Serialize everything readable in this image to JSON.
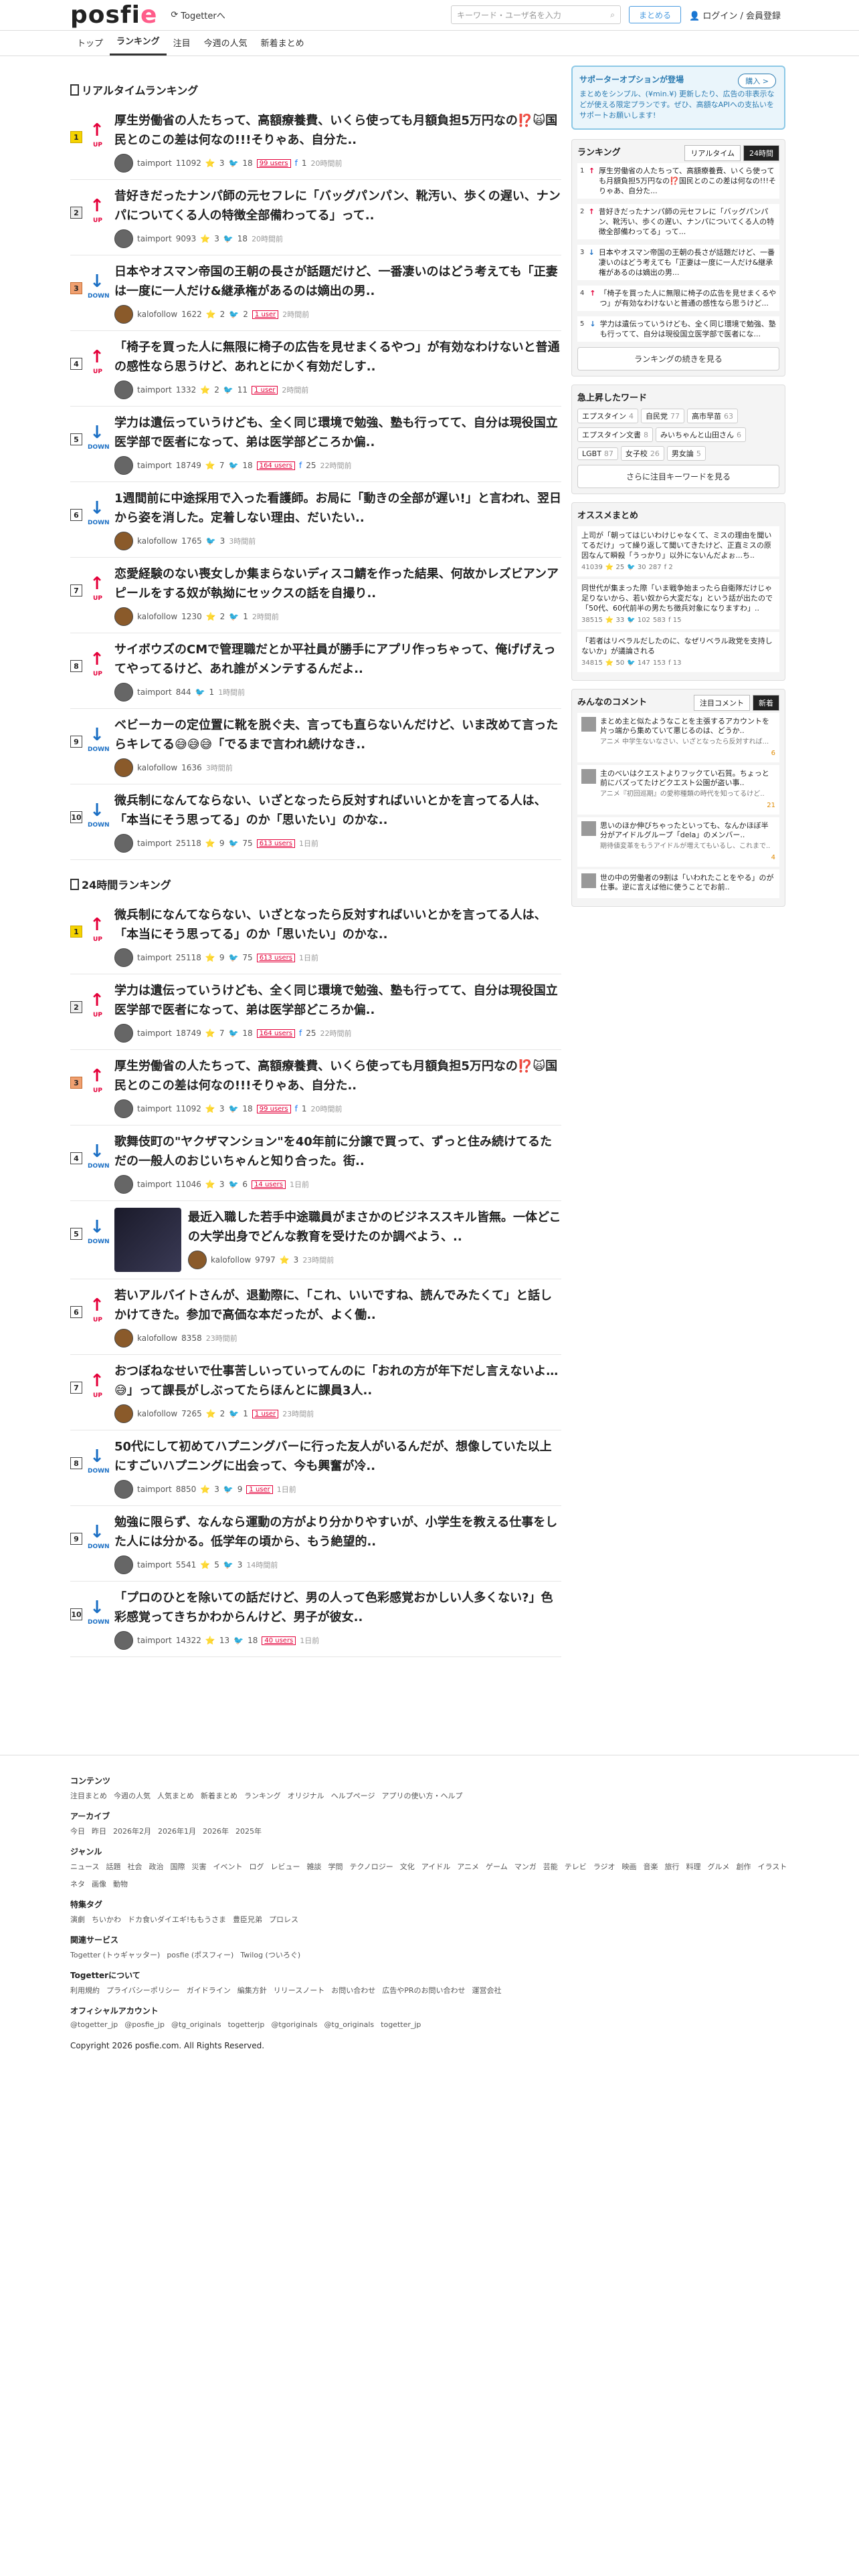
{
  "header": {
    "logo": "posfie",
    "togetter": "Togetterへ",
    "search_placeholder": "キーワード・ユーザ名を入力",
    "matome_btn": "まとめる",
    "login": "ログイン / 会員登録"
  },
  "nav": [
    "トップ",
    "ランキング",
    "注目",
    "今週の人気",
    "新着まとめ"
  ],
  "realtime": {
    "title": "リアルタイムランキング",
    "items": [
      {
        "n": "1",
        "dir": "UP",
        "title": "厚生労働省の人たちって、高額療養費、いくら使っても月額負担5万円なの⁉️🙀国民とのこの差は何なの!!!そりゃあ、自分た..",
        "user": "taimport",
        "views": "11092",
        "stars": "3",
        "tw": "18",
        "users": "99 users",
        "fb": "1",
        "time": "20時間前"
      },
      {
        "n": "2",
        "dir": "UP",
        "title": "昔好きだったナンパ師の元セフレに「バッグパンパン、靴汚い、歩くの遅い、ナンパについてくる人の特徴全部備わってる」って..",
        "user": "taimport",
        "views": "9093",
        "stars": "3",
        "tw": "18",
        "users": "",
        "fb": "",
        "time": "20時間前"
      },
      {
        "n": "3",
        "dir": "DOWN",
        "title": "日本やオスマン帝国の王朝の長さが話題だけど、一番凄いのはどう考えても「正妻は一度に一人だけ&継承権があるのは嫡出の男..",
        "user": "kalofollow",
        "views": "1622",
        "stars": "2",
        "tw": "2",
        "users": "1 user",
        "fb": "",
        "time": "2時間前"
      },
      {
        "n": "4",
        "dir": "UP",
        "title": "「椅子を買った人に無限に椅子の広告を見せまくるやつ」が有効なわけないと普通の感性なら思うけど、あれとにかく有効だしす..",
        "user": "taimport",
        "views": "1332",
        "stars": "2",
        "tw": "11",
        "users": "1 user",
        "fb": "",
        "time": "2時間前"
      },
      {
        "n": "5",
        "dir": "DOWN",
        "title": "学力は遺伝っていうけども、全く同じ環境で勉強、塾も行ってて、自分は現役国立医学部で医者になって、弟は医学部どころか偏..",
        "user": "taimport",
        "views": "18749",
        "stars": "7",
        "tw": "18",
        "users": "164 users",
        "fb": "25",
        "time": "22時間前"
      },
      {
        "n": "6",
        "dir": "DOWN",
        "title": "1週間前に中途採用で入った看護師。お局に「動きの全部が遅い!」と言われ、翌日から姿を消した。定着しない理由、だいたい..",
        "user": "kalofollow",
        "views": "1765",
        "stars": "",
        "tw": "3",
        "users": "",
        "fb": "",
        "time": "3時間前"
      },
      {
        "n": "7",
        "dir": "UP",
        "title": "恋愛経験のない喪女しか集まらないディスコ鯖を作った結果、何故かレズビアンアピールをする奴が執拗にセックスの話を自撮り..",
        "user": "kalofollow",
        "views": "1230",
        "stars": "2",
        "tw": "1",
        "users": "",
        "fb": "",
        "time": "2時間前"
      },
      {
        "n": "8",
        "dir": "UP",
        "title": "サイボウズのCMで管理職だとか平社員が勝手にアプリ作っちゃって、俺げげえってやってるけど、あれ誰がメンテするんだよ..",
        "user": "taimport",
        "views": "844",
        "stars": "",
        "tw": "1",
        "users": "",
        "fb": "",
        "time": "1時間前"
      },
      {
        "n": "9",
        "dir": "DOWN",
        "title": "ベビーカーの定位置に靴を脱ぐ夫、言っても直らないんだけど、いま改めて言ったらキレてる😅😅😅「でるまで言われ続けなき..",
        "user": "kalofollow",
        "views": "1636",
        "stars": "",
        "tw": "",
        "users": "",
        "fb": "",
        "time": "3時間前"
      },
      {
        "n": "10",
        "dir": "DOWN",
        "title": "微兵制になんてならない、いざとなったら反対すればいいとかを言ってる人は、「本当にそう思ってる」のか「思いたい」のかな..",
        "user": "taimport",
        "views": "25118",
        "stars": "9",
        "tw": "75",
        "users": "613 users",
        "fb": "",
        "time": "1日前"
      }
    ]
  },
  "daily": {
    "title": "24時間ランキング",
    "items": [
      {
        "n": "1",
        "dir": "UP",
        "title": "微兵制になんてならない、いざとなったら反対すればいいとかを言ってる人は、「本当にそう思ってる」のか「思いたい」のかな..",
        "user": "taimport",
        "views": "25118",
        "stars": "9",
        "tw": "75",
        "users": "613 users",
        "fb": "",
        "time": "1日前",
        "thumb": false
      },
      {
        "n": "2",
        "dir": "UP",
        "title": "学力は遺伝っていうけども、全く同じ環境で勉強、塾も行ってて、自分は現役国立医学部で医者になって、弟は医学部どころか偏..",
        "user": "taimport",
        "views": "18749",
        "stars": "7",
        "tw": "18",
        "users": "164 users",
        "fb": "25",
        "time": "22時間前",
        "thumb": false
      },
      {
        "n": "3",
        "dir": "UP",
        "title": "厚生労働省の人たちって、高額療養費、いくら使っても月額負担5万円なの⁉️🙀国民とのこの差は何なの!!!そりゃあ、自分た..",
        "user": "taimport",
        "views": "11092",
        "stars": "3",
        "tw": "18",
        "users": "99 users",
        "fb": "1",
        "time": "20時間前",
        "thumb": false
      },
      {
        "n": "4",
        "dir": "DOWN",
        "title": "歌舞伎町の\"ヤクザマンション\"を40年前に分譲で買って、ずっと住み続けてるただの一般人のおじいちゃんと知り合った。街..",
        "user": "taimport",
        "views": "11046",
        "stars": "3",
        "tw": "6",
        "users": "14 users",
        "fb": "",
        "time": "1日前",
        "thumb": false
      },
      {
        "n": "5",
        "dir": "DOWN",
        "title": "最近入職した若手中途職員がまさかのビジネススキル皆無。一体どこの大学出身でどんな教育を受けたのか調べよう、..",
        "user": "kalofollow",
        "views": "9797",
        "stars": "3",
        "tw": "",
        "users": "",
        "fb": "",
        "time": "23時間前",
        "thumb": true
      },
      {
        "n": "6",
        "dir": "UP",
        "title": "若いアルバイトさんが、退勤際に、「これ、いいですね、読んでみたくて」と話しかけてきた。参加で高価な本だったが、よく働..",
        "user": "kalofollow",
        "views": "8358",
        "stars": "",
        "tw": "",
        "users": "",
        "fb": "",
        "time": "23時間前",
        "thumb": false
      },
      {
        "n": "7",
        "dir": "UP",
        "title": "おつぼねなせいで仕事苦しいっていってんのに「おれの方が年下だし言えないよ…😅」って課長がしぶってたらほんとに課員3人..",
        "user": "kalofollow",
        "views": "7265",
        "stars": "2",
        "tw": "1",
        "users": "1 user",
        "fb": "",
        "time": "23時間前",
        "thumb": false
      },
      {
        "n": "8",
        "dir": "DOWN",
        "title": "50代にして初めてハプニングバーに行った友人がいるんだが、想像していた以上にすごいハプニングに出会って、今も興奮が冷..",
        "user": "taimport",
        "views": "8850",
        "stars": "3",
        "tw": "9",
        "users": "1 user",
        "fb": "",
        "time": "1日前",
        "thumb": false
      },
      {
        "n": "9",
        "dir": "DOWN",
        "title": "勉強に限らず、なんなら運動の方がより分かりやすいが、小学生を教える仕事をした人には分かる。低学年の頃から、もう絶望的..",
        "user": "taimport",
        "views": "5541",
        "stars": "5",
        "tw": "3",
        "users": "",
        "fb": "",
        "time": "14時間前",
        "thumb": false
      },
      {
        "n": "10",
        "dir": "DOWN",
        "title": "「プロのひとを除いての話だけど、男の人って色彩感覚おかしい人多くない?」色彩感覚ってきちかわからんけど、男子が彼女..",
        "user": "taimport",
        "views": "14322",
        "stars": "13",
        "tw": "18",
        "users": "40 users",
        "fb": "",
        "time": "1日前",
        "thumb": false
      }
    ]
  },
  "sidebar": {
    "promo_title": "サポーターオプションが登場",
    "promo_body": "まとめをシンプル、(¥min.¥) 更新したり、広告の非表示などが使える限定プランです。ぜひ、高額なAPIへの支払いをサポートお願いします!",
    "buy_btn": "購入 >",
    "ranking_title": "ランキング",
    "tab_rt": "リアルタイム",
    "tab_24": "24時間",
    "ranking": [
      {
        "n": "1",
        "dir": "UP",
        "text": "厚生労働省の人たちって、高額療養費、いくら使っても月額負担5万円なの⁉️国民とのこの差は何なの!!!そりゃあ、自分た..."
      },
      {
        "n": "2",
        "dir": "UP",
        "text": "昔好きだったナンパ師の元セフレに「バッグパンパン、靴汚い、歩くの遅い、ナンパについてくる人の特徴全部備わってる」って..."
      },
      {
        "n": "3",
        "dir": "DOWN",
        "text": "日本やオスマン帝国の王朝の長さが話題だけど、一番凄いのはどう考えても「正妻は一度に一人だけ&継承権があるのは嫡出の男..."
      },
      {
        "n": "4",
        "dir": "UP",
        "text": "「椅子を買った人に無限に椅子の広告を見せまくるやつ」が有効なわけないと普通の感性なら思うけど..."
      },
      {
        "n": "5",
        "dir": "DOWN",
        "text": "学力は遺伝っていうけども、全く同じ環境で勉強、塾も行ってて、自分は現役国立医学部で医者にな..."
      }
    ],
    "ranking_more": "ランキングの続きを見る",
    "kw_title": "急上昇したワード",
    "keywords": [
      {
        "w": "エプスタイン",
        "c": "4"
      },
      {
        "w": "自民党",
        "c": "77"
      },
      {
        "w": "高市早苗",
        "c": "63"
      },
      {
        "w": "エプスタイン文書",
        "c": "8"
      },
      {
        "w": "みいちゃんと山田さん",
        "c": "6"
      },
      {
        "w": "LGBT",
        "c": "87"
      },
      {
        "w": "女子校",
        "c": "26"
      },
      {
        "w": "男女論",
        "c": "5"
      }
    ],
    "kw_more": "さらに注目キーワードを見る",
    "osu_title": "オススメまとめ",
    "osu": [
      {
        "text": "上司が「朝ってはじいわけじゃなくて、ミスの理由を聞いてるだけ」って繰り返して聞いてきたけど、正直ミスの原因なんて瞬殺「うっかり」以外にないんだよぉ...ち..",
        "views": "41039",
        "s": "25",
        "tw": "30",
        "u": "287",
        "fb": "2"
      },
      {
        "text": "同世代が集まった際「いま戦争始まったら自衛隊だけじゃ足りないから、若い奴から大変だな」という話が出たので「50代、60代前半の男たち徴兵対象になりますわ」..",
        "views": "38515",
        "s": "33",
        "tw": "102",
        "u": "583",
        "fb": "15"
      },
      {
        "text": "「若者はリベラルだしたのに、なぜリベラル政党を支持しないか」が議論される",
        "views": "34815",
        "s": "50",
        "tw": "147",
        "u": "153",
        "fb": "13"
      }
    ],
    "cm_title": "みんなのコメント",
    "cm_tab1": "注目コメント",
    "cm_tab2": "新着",
    "comments": [
      {
        "text": "まとめ主と似たようなことを主張するアカウントを片っ端から集めていて悪じるのは、どうか..",
        "sub": "アニメ 中学生ないなさい、いざとなったら反対すれば...",
        "likes": "6"
      },
      {
        "text": "主のべいはクエストよりフックてい石質。ちょっと前にバズってたけどクエスト公園が盗い事..",
        "sub": "アニメ『初回巡期』の愛称種類の時代を知ってるけど..",
        "likes": "21"
      },
      {
        "text": "思いのほか伸びちゃったといっても、なんかほぼ半分がアイドルグループ「dela」のメンバー..",
        "sub": "期待値変革をもうアイドルが増えてもいるし、これまで..",
        "likes": "4"
      },
      {
        "text": "世の中の労働者の9割は「いわれたことをやる」のが仕事。逆に言えば他に使うことでお前..",
        "sub": "",
        "likes": ""
      }
    ]
  },
  "footer": {
    "contents_h": "コンテンツ",
    "contents": [
      "注目まとめ",
      "今週の人気",
      "人気まとめ",
      "新着まとめ",
      "ランキング",
      "オリジナル",
      "ヘルプページ",
      "アプリの使い方・ヘルプ"
    ],
    "archive_h": "アーカイブ",
    "archive": [
      "今日",
      "昨日",
      "2026年2月",
      "2026年1月",
      "2026年",
      "2025年"
    ],
    "genre_h": "ジャンル",
    "genre": [
      "ニュース",
      "話題",
      "社会",
      "政治",
      "国際",
      "災害",
      "イベント",
      "ログ",
      "レビュー",
      "雑談",
      "学問",
      "テクノロジー",
      "文化",
      "アイドル",
      "アニメ",
      "ゲーム",
      "マンガ",
      "芸能",
      "テレビ",
      "ラジオ",
      "映画",
      "音楽",
      "旅行",
      "料理",
      "グルメ",
      "創作",
      "イラスト",
      "ネタ",
      "画像",
      "動物"
    ],
    "tag_h": "特集タグ",
    "tags": [
      "演劇",
      "ちいかわ",
      "ドカ食いダイエギ!ももうさま",
      "豊臣兄弟",
      "プロレス"
    ],
    "rel_h": "関連サービス",
    "rel": [
      "Togetter (トゥギャッター)",
      "posfie (ポスフィー)",
      "Twilog (ついろぐ)"
    ],
    "about_h": "Togetterについて",
    "about": [
      "利用規約",
      "プライバシーポリシー",
      "ガイドライン",
      "編集方針",
      "リリースノート",
      "お問い合わせ",
      "広告やPRのお問い合わせ",
      "運営会社"
    ],
    "off_h": "オフィシャルアカウント",
    "off": [
      "@togetter_jp",
      "@posfie_jp",
      "@tg_originals",
      "togetterjp",
      "@tgoriginals",
      "@tg_originals",
      "togetter_jp"
    ],
    "copy": "Copyright 2026 posfie.com. All Rights Reserved."
  }
}
